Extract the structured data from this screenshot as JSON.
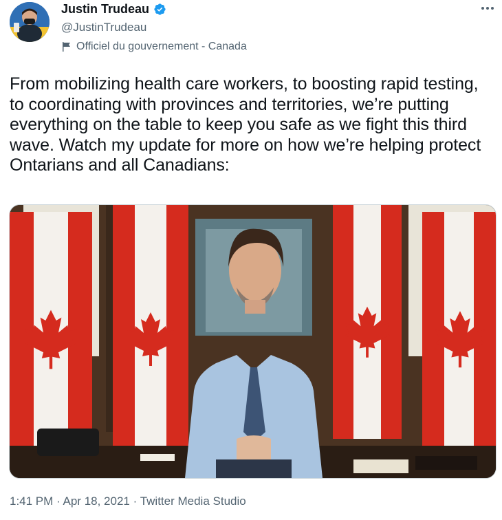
{
  "tweet": {
    "author": {
      "display_name": "Justin Trudeau",
      "handle": "@JustinTrudeau",
      "verified": true,
      "label": "Officiel du gouvernement - Canada",
      "avatar_icon": "profile-photo"
    },
    "text": "From mobilizing health care workers, to boosting rapid testing, to coordinating with provinces and territories, we’re putting everything on the table to keep you safe as we fight this third wave. Watch my update for more on how we’re helping protect Ontarians and all Canadians:",
    "media": {
      "type": "video",
      "description_icon": "video-thumbnail"
    },
    "time": "1:41 PM",
    "separator": "·",
    "date": "Apr 18, 2021",
    "source": "Twitter Media Studio"
  },
  "icons": {
    "verified": "verified-badge-icon",
    "label": "flag-icon",
    "more": "more-options-icon"
  },
  "colors": {
    "verified_blue": "#1d9bf0",
    "secondary_text": "#536471",
    "primary_text": "#0f1419",
    "flag_red": "#d52b1e"
  }
}
